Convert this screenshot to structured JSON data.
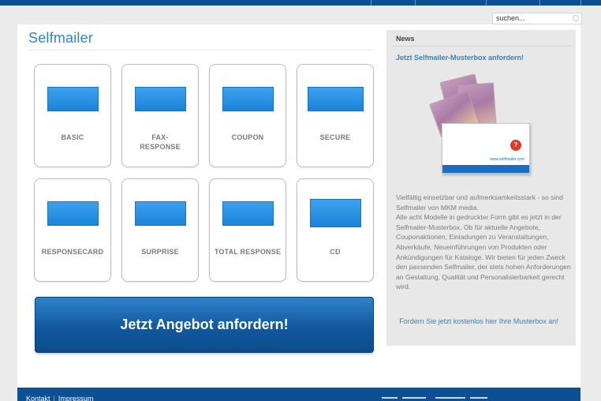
{
  "colors": {
    "brand_blue": "#0d4f93",
    "link_blue": "#2e86c1",
    "envelope_blue": "#1a83d8"
  },
  "search": {
    "placeholder": "suchen...",
    "icon": "search-icon"
  },
  "main": {
    "title": "Selfmailer",
    "products": [
      {
        "label": "BASIC"
      },
      {
        "label": "FAX-\nRESPONSE"
      },
      {
        "label": "COUPON"
      },
      {
        "label": "SECURE"
      },
      {
        "label": "RESPONSECARD"
      },
      {
        "label": "SURPRISE"
      },
      {
        "label": "TOTAL RESPONSE"
      },
      {
        "label": "CD"
      }
    ],
    "cta_label": "Jetzt Angebot anfordern!"
  },
  "news": {
    "heading": "News",
    "link": "Jetzt Selfmailer-Musterbox anfordern!",
    "box_url": "www.selfmailer.com",
    "body": "Vielfältig einsetzbar und aufmerksamkeitsstark - so sind Selfmailer von MKM media.\nAlle acht Modelle in gedruckter Form gibt es jetzt in der Selfmailer-Musterbox. Ob für aktuelle Angebote, Couponaktionen, Einladungen zu Veranstaltungen, Abverkäufe, Neueinführungen von Produkten oder Ankündigungen für Kataloge. Wir bieten für jeden Zweck den passenden Selfmailer, der  stets hohen Anforderungen an Gestaltung, Qualität und Personalisierbarkeit gerecht wird.",
    "cta": "Fordern Sie jetzt kostenlos hier Ihre Musterbox an!"
  },
  "footer": {
    "links": [
      "Kontakt",
      "Impressum"
    ],
    "separator": "|"
  }
}
